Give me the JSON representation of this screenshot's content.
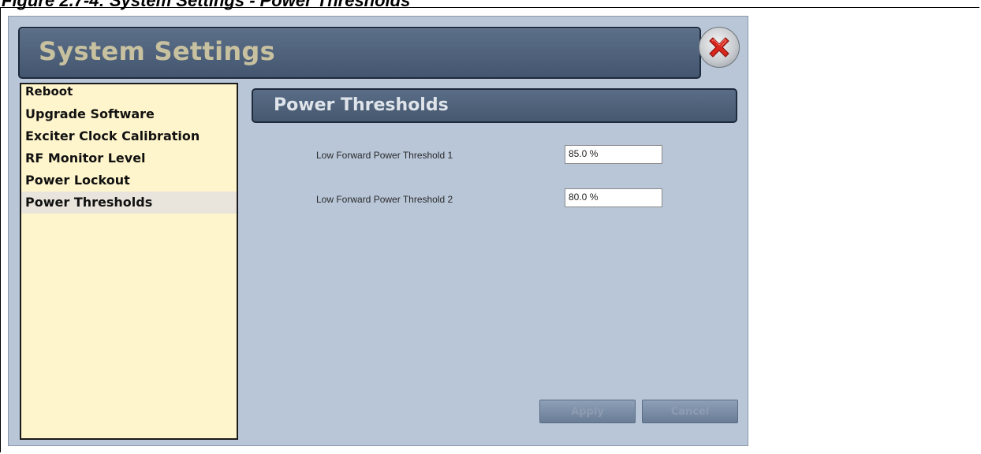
{
  "figure_caption": "Figure 2.7-4: System Settings - Power Thresholds",
  "window": {
    "title": "System Settings",
    "close_icon": "close-x-icon"
  },
  "sidebar": {
    "items": [
      {
        "label": "Reboot",
        "selected": false
      },
      {
        "label": "Upgrade Software",
        "selected": false
      },
      {
        "label": "Exciter Clock Calibration",
        "selected": false
      },
      {
        "label": "RF Monitor Level",
        "selected": false
      },
      {
        "label": "Power Lockout",
        "selected": false
      },
      {
        "label": "Power Thresholds",
        "selected": true
      }
    ]
  },
  "main": {
    "section_title": "Power Thresholds",
    "fields": [
      {
        "label": "Low Forward Power Threshold 1",
        "value": "85.0 %"
      },
      {
        "label": "Low Forward Power Threshold 2",
        "value": "80.0 %"
      }
    ]
  },
  "buttons": {
    "apply_label": "Apply",
    "cancel_label": "Cancel"
  },
  "colors": {
    "background": "#b8c6d8",
    "title_bar": "#4f627c",
    "title_text": "#c8c1a0",
    "sidebar_bg": "#fff5cc",
    "close_x": "#d8261c"
  }
}
